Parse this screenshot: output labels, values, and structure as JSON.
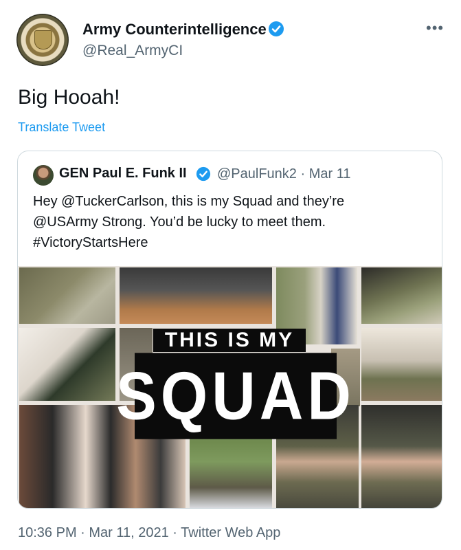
{
  "author": {
    "name": "Army Counterintelligence",
    "handle": "@Real_ArmyCI",
    "verified": true
  },
  "tweet": {
    "text": "Big Hooah!",
    "translate_label": "Translate Tweet"
  },
  "quoted": {
    "name": "GEN Paul E. Funk II",
    "handle_date": "@PaulFunk2 · Mar 11",
    "text_lines": [
      "Hey @TuckerCarlson, this is my Squad and they’re",
      "@USArmy Strong. You’d be lucky to meet them.",
      "#VictoryStartsHere"
    ],
    "image_banner_top": "THIS IS MY",
    "image_banner_main": "SQUAD"
  },
  "footer": {
    "meta": "10:36 PM · Mar 11, 2021 · Twitter Web App"
  },
  "icons": {
    "more": "more-options-icon",
    "verified": "verified-badge-icon"
  },
  "colors": {
    "link": "#1d9bf0",
    "secondary_text": "#536471",
    "verified": "#1d9bf0",
    "border": "#cfd9de"
  }
}
